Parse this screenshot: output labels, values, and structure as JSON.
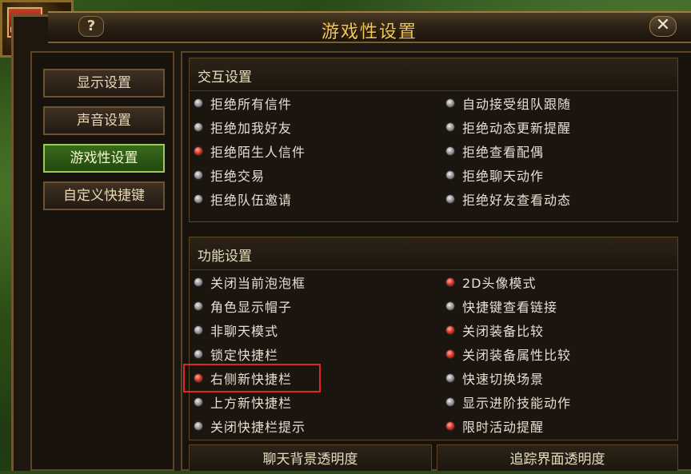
{
  "window": {
    "title": "游戏性设置",
    "help_icon": "?",
    "close_icon": "✕"
  },
  "sidebar": {
    "items": [
      {
        "label": "显示设置",
        "active": false
      },
      {
        "label": "声音设置",
        "active": false
      },
      {
        "label": "游戏性设置",
        "active": true
      },
      {
        "label": "自定义快捷键",
        "active": false
      }
    ]
  },
  "interaction": {
    "title": "交互设置",
    "left": [
      {
        "label": "拒绝所有信件",
        "on": false
      },
      {
        "label": "拒绝加我好友",
        "on": false
      },
      {
        "label": "拒绝陌生人信件",
        "on": true
      },
      {
        "label": "拒绝交易",
        "on": false
      },
      {
        "label": "拒绝队伍邀请",
        "on": false
      }
    ],
    "right": [
      {
        "label": "自动接受组队跟随",
        "on": false
      },
      {
        "label": "拒绝动态更新提醒",
        "on": false
      },
      {
        "label": "拒绝查看配偶",
        "on": false
      },
      {
        "label": "拒绝聊天动作",
        "on": false
      },
      {
        "label": "拒绝好友查看动态",
        "on": false
      }
    ]
  },
  "function": {
    "title": "功能设置",
    "left": [
      {
        "label": "关闭当前泡泡框",
        "on": false
      },
      {
        "label": "角色显示帽子",
        "on": false
      },
      {
        "label": "非聊天模式",
        "on": false
      },
      {
        "label": "锁定快捷栏",
        "on": false
      },
      {
        "label": "右侧新快捷栏",
        "on": true
      },
      {
        "label": "上方新快捷栏",
        "on": false
      },
      {
        "label": "关闭快捷栏提示",
        "on": false
      }
    ],
    "right": [
      {
        "label": "2D头像模式",
        "on": true
      },
      {
        "label": "快捷键查看链接",
        "on": false
      },
      {
        "label": "关闭装备比较",
        "on": true
      },
      {
        "label": "关闭装备属性比较",
        "on": true
      },
      {
        "label": "快速切换场景",
        "on": false
      },
      {
        "label": "显示进阶技能动作",
        "on": false
      },
      {
        "label": "限时活动提醒",
        "on": true
      }
    ]
  },
  "bottom": {
    "chat_bg_opacity": "聊天背景透明度",
    "tracker_opacity": "追踪界面透明度"
  },
  "colors": {
    "accent_title": "#f0c860",
    "active_tab": "#3a6a1a",
    "highlight_box": "#e0262a",
    "radio_on": "#e03a2a"
  }
}
